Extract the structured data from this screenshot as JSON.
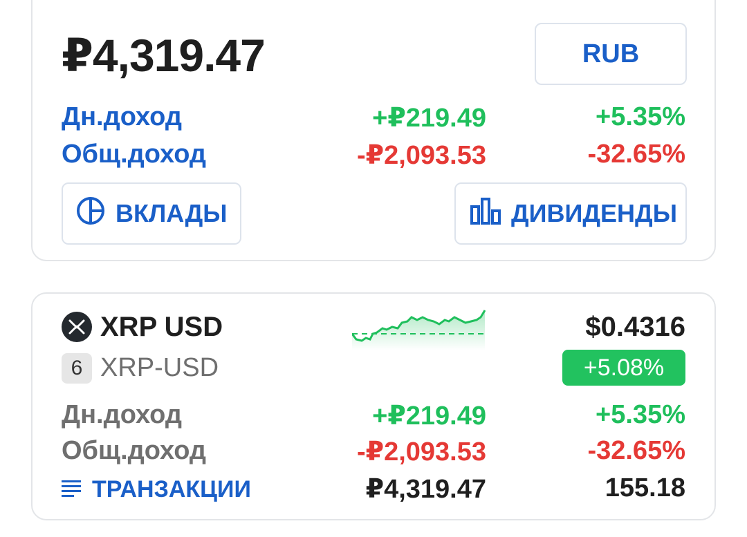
{
  "portfolio": {
    "total": "₽4,319.47",
    "currency_button": "RUB",
    "daily_label": "Дн.доход",
    "daily_value": "+₽219.49",
    "daily_pct": "+5.35%",
    "total_label": "Общ.доход",
    "total_value": "-₽2,093.53",
    "total_pct": "-32.65%",
    "deposits_button": "ВКЛАДЫ",
    "dividends_button": "ДИВИДЕНДЫ"
  },
  "asset": {
    "name": "XRP USD",
    "symbol": "XRP-USD",
    "badge": "6",
    "price": "$0.4316",
    "change_pct": "+5.08%",
    "daily_label": "Дн.доход",
    "daily_value": "+₽219.49",
    "daily_pct": "+5.35%",
    "total_label": "Общ.доход",
    "total_value": "-₽2,093.53",
    "total_pct": "-32.65%",
    "transactions_label": "ТРАНЗАКЦИИ",
    "holdings_value": "₽4,319.47",
    "quantity": "155.18"
  },
  "colors": {
    "accent": "#1a5fc8",
    "gain": "#1fbf5c",
    "loss": "#e53935"
  },
  "icons": [
    "pie-chart-icon",
    "bar-chart-icon",
    "xrp-logo-icon",
    "list-icon"
  ]
}
